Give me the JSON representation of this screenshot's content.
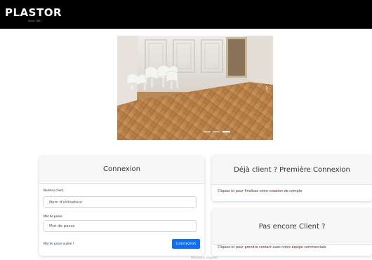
{
  "header": {
    "logo": "PLASTOR",
    "tagline": "Since 1927"
  },
  "carousel": {
    "prev_icon": "chevron-left-icon",
    "next_icon": "chevron-right-icon",
    "slide_count": 3,
    "active_slide": 2
  },
  "login": {
    "title": "Connexion",
    "client_label": "Numéro client",
    "client_placeholder": "Nom d'utilisateur",
    "password_label": "Mot de passe",
    "password_placeholder": "Mot de passe",
    "forgot_link": "Mot de passe oublié ?",
    "submit_label": "Connexion"
  },
  "first_connection": {
    "title": "Déjà client ? Première Connexion",
    "link": "Cliquez ici pour finalisez votre création de compte"
  },
  "new_client": {
    "title": "Pas encore Client ?",
    "link": "Cliquez-ici pour prendre contact avec notre équipe commerciale."
  },
  "footer": {
    "text": "Mentions légales"
  },
  "colors": {
    "header_bg": "#000000",
    "button_primary": "#0d6efd",
    "link_brown": "#5a2f1b",
    "floor_wood": "#b98a55"
  }
}
